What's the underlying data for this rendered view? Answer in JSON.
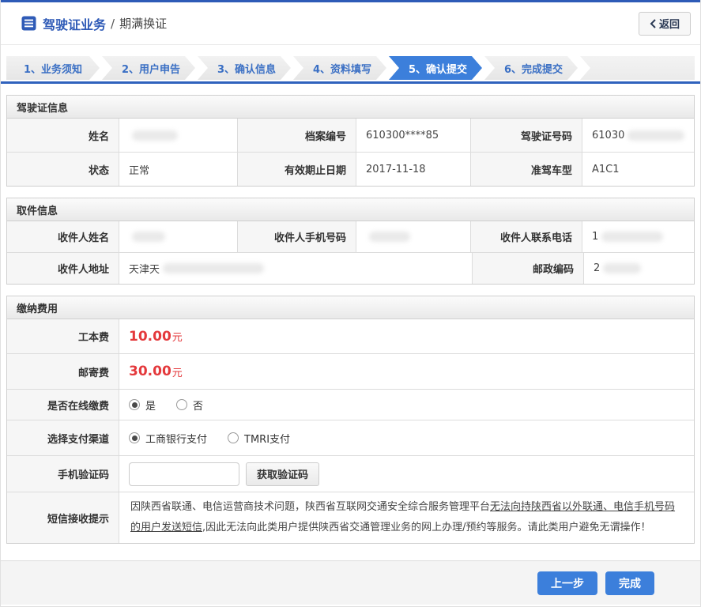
{
  "header": {
    "title_main": "驾驶证业务",
    "title_separator": "/",
    "title_sub": "期满换证",
    "back_button": "返回"
  },
  "steps": [
    {
      "label": "1、业务须知",
      "active": false
    },
    {
      "label": "2、用户申告",
      "active": false
    },
    {
      "label": "3、确认信息",
      "active": false
    },
    {
      "label": "4、资料填写",
      "active": false
    },
    {
      "label": "5、确认提交",
      "active": true
    },
    {
      "label": "6、完成提交",
      "active": false
    }
  ],
  "license_info": {
    "title": "驾驶证信息",
    "name_label": "姓名",
    "name_value": "",
    "file_number_label": "档案编号",
    "file_number_value": "610300****85",
    "license_number_label": "驾驶证号码",
    "license_number_value": "61030",
    "status_label": "状态",
    "status_value": "正常",
    "valid_until_label": "有效期止日期",
    "valid_until_value": "2017-11-18",
    "vehicle_class_label": "准驾车型",
    "vehicle_class_value": "A1C1"
  },
  "pickup_info": {
    "title": "取件信息",
    "recipient_name_label": "收件人姓名",
    "recipient_name_value": "",
    "recipient_mobile_label": "收件人手机号码",
    "recipient_mobile_value": "",
    "recipient_phone_label": "收件人联系电话",
    "recipient_phone_value": "1",
    "recipient_address_label": "收件人地址",
    "recipient_address_value": "天津天",
    "postal_code_label": "邮政编码",
    "postal_code_value": "2"
  },
  "payment": {
    "title": "缴纳费用",
    "production_fee_label": "工本费",
    "production_fee_amount": "10.00",
    "mailing_fee_label": "邮寄费",
    "mailing_fee_amount": "30.00",
    "currency_unit": "元",
    "online_pay_label": "是否在线缴费",
    "online_pay_yes": "是",
    "online_pay_no": "否",
    "online_pay_selected": "是",
    "channel_label": "选择支付渠道",
    "channel_icbc": "工商银行支付",
    "channel_tmri": "TMRI支付",
    "channel_selected": "工商银行支付",
    "sms_code_label": "手机验证码",
    "sms_code_value": "",
    "get_code_button": "获取验证码",
    "notice_label": "短信接收提示",
    "notice_text_part1": "因陕西省联通、电信运营商技术问题，陕西省互联网交通安全综合服务管理平台",
    "notice_text_underlined": "无法向持陕西省以外联通、电信手机号码的用户发送短信",
    "notice_text_part2": ",因此无法向此类用户提供陕西省交通管理业务的网上办理/预约等服务。请此类用户避免无谓操作！"
  },
  "footer": {
    "prev_button": "上一步",
    "finish_button": "完成"
  },
  "colors": {
    "top_line_blue": "#2e5bb7",
    "accent_blue": "#3c7fdb",
    "step_text_blue": "#3a6fc4",
    "fee_red": "#e4393c",
    "notice_red": "#c75450"
  }
}
